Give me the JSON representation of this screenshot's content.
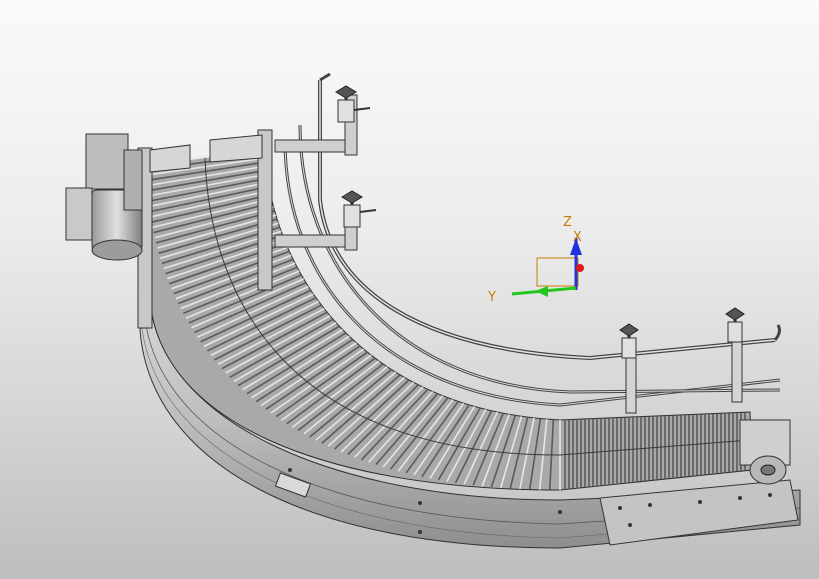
{
  "scene": {
    "model": "curved-chain-conveyor",
    "colors": {
      "background_top": "#fafafa",
      "background_bottom": "#bdbdbd",
      "metal_light": "#e8e8e8",
      "metal_mid": "#b9b9b9",
      "metal_dark": "#7a7a7a",
      "edge": "#333333"
    }
  },
  "triad": {
    "labels": {
      "x": "X",
      "y": "Y",
      "z": "Z"
    },
    "colors": {
      "x": "#e01818",
      "y": "#22c81e",
      "z": "#2233dd",
      "label": "#c87a00"
    }
  }
}
